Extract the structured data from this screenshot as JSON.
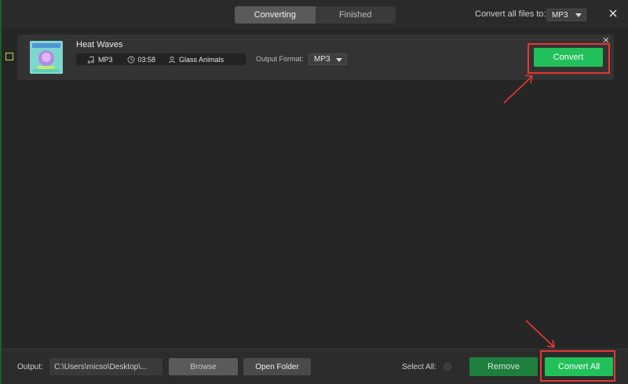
{
  "header": {
    "tabs": [
      {
        "label": "Converting",
        "active": true
      },
      {
        "label": "Finished",
        "active": false
      }
    ],
    "convert_all_label": "Convert all files to:",
    "convert_all_format": "MP3"
  },
  "item": {
    "title": "Heat Waves",
    "format": "MP3",
    "duration": "03:58",
    "artist": "Glass Animals",
    "output_format_label": "Output Format:",
    "output_format_value": "MP3",
    "convert_label": "Convert"
  },
  "footer": {
    "output_label": "Output:",
    "output_path": "C:\\Users\\micso\\Desktop\\...",
    "browse_label": "Browse",
    "open_folder_label": "Open Folder",
    "select_all_label": "Select All:",
    "remove_label": "Remove",
    "convert_all_label": "Convert All"
  },
  "colors": {
    "accent_green": "#22c05a",
    "remove_green": "#1f7f3f",
    "highlight_red": "#e53935",
    "background": "#262626",
    "card": "#333333"
  },
  "icons": [
    "music-note-icon",
    "clock-icon",
    "person-icon",
    "close-icon",
    "chevron-down-icon"
  ]
}
